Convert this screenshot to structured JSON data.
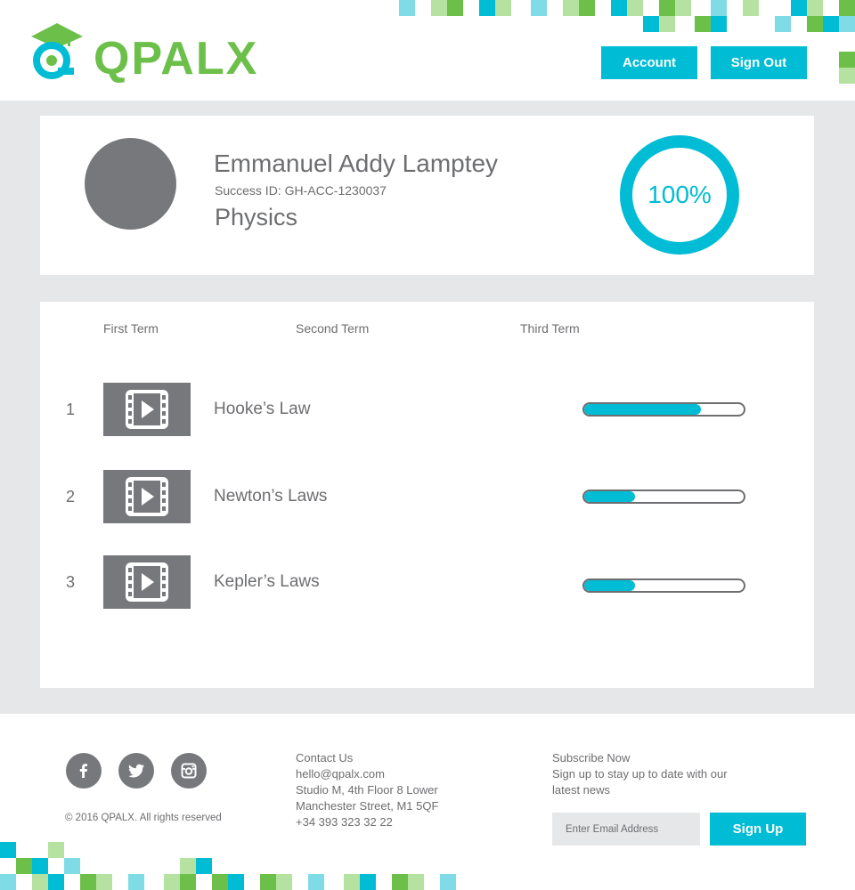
{
  "brand": {
    "name": "QPALX"
  },
  "colors": {
    "accent": "#00bcd4",
    "brand_green": "#6cc04a",
    "text": "#6d6e71",
    "avatar": "#77787b"
  },
  "header": {
    "account_label": "Account",
    "signout_label": "Sign Out"
  },
  "profile": {
    "name": "Emmanuel Addy Lamptey",
    "success_id": "Success ID: GH-ACC-1230037",
    "subject": "Physics",
    "overall_progress_label": "100%",
    "overall_progress": 1.0
  },
  "tabs": [
    {
      "label": "First Term",
      "active": true
    },
    {
      "label": "Second Term",
      "active": false
    },
    {
      "label": "Third Term",
      "active": false
    }
  ],
  "topics": [
    {
      "index": "1",
      "title": "Hooke’s Law",
      "icon": "video-icon",
      "progress": 0.73
    },
    {
      "index": "2",
      "title": "Newton’s Laws",
      "icon": "video-icon",
      "progress": 0.32
    },
    {
      "index": "3",
      "title": "Kepler’s Laws",
      "icon": "video-icon",
      "progress": 0.32
    }
  ],
  "footer": {
    "social": [
      "facebook-icon",
      "twitter-icon",
      "instagram-icon"
    ],
    "copyright": "© 2016 QPALX. All rights reserved",
    "contact": {
      "heading": "Contact Us",
      "email": "hello@qpalx.com",
      "address_line1": "Studio M, 4th Floor 8 Lower",
      "address_line2": "Manchester Street, M1 5QF",
      "phone": "+34 393 323 32 22"
    },
    "subscribe": {
      "heading": "Subscribe Now",
      "text": "Sign up to stay up to date with our latest news",
      "placeholder": "Enter Email Address",
      "button_label": "Sign Up"
    }
  }
}
